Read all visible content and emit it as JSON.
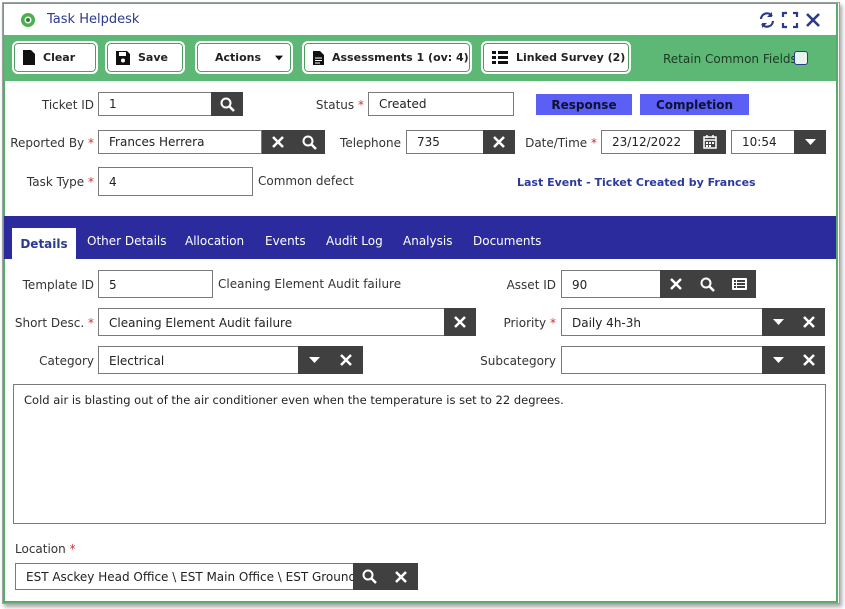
{
  "window": {
    "title": "Task Helpdesk"
  },
  "toolbar": {
    "clear_label": "Clear",
    "save_label": "Save",
    "actions_label": "Actions",
    "assessments_label": "Assessments 1 (ov: 4)",
    "linked_survey_label": "Linked Survey (2)",
    "retain_label": "Retain Common Fields",
    "retain_checked": false
  },
  "header_form": {
    "ticket_id_label": "Ticket ID",
    "ticket_id": "1",
    "status_label": "Status",
    "status": "Created",
    "response_label": "Response",
    "completion_label": "Completion",
    "reported_by_label": "Reported By",
    "reported_by": "Frances Herrera",
    "telephone_label": "Telephone",
    "telephone": "735",
    "datetime_label": "Date/Time",
    "date": "23/12/2022",
    "time": "10:54",
    "task_type_label": "Task Type",
    "task_type": "4",
    "task_type_desc": "Common defect",
    "last_event": "Last Event -  Ticket Created by Frances"
  },
  "tabs": [
    "Details",
    "Other Details",
    "Allocation",
    "Events",
    "Audit Log",
    "Analysis",
    "Documents"
  ],
  "details": {
    "template_id_label": "Template ID",
    "template_id": "5",
    "template_desc": "Cleaning Element Audit failure",
    "asset_id_label": "Asset ID",
    "asset_id": "90",
    "short_desc_label": "Short Desc.",
    "short_desc": "Cleaning  Element Audit  failure",
    "priority_label": "Priority",
    "priority": "Daily 4h-3h",
    "category_label": "Category",
    "category": "Electrical",
    "subcategory_label": "Subcategory",
    "subcategory": "",
    "description": "Cold air is blasting out of the air conditioner even when the temperature is set to 22 degrees.",
    "location_label": "Location",
    "location": "EST Asckey Head Office \\ EST Main Office \\ EST Ground Fl"
  },
  "colors": {
    "toolbar_green": "#5cb874",
    "tabbar_blue": "#2b2b9e",
    "accent_button": "#5b5ff5",
    "title_blue": "#2b3a8c",
    "icon_button": "#404040",
    "required": "#d23030"
  }
}
